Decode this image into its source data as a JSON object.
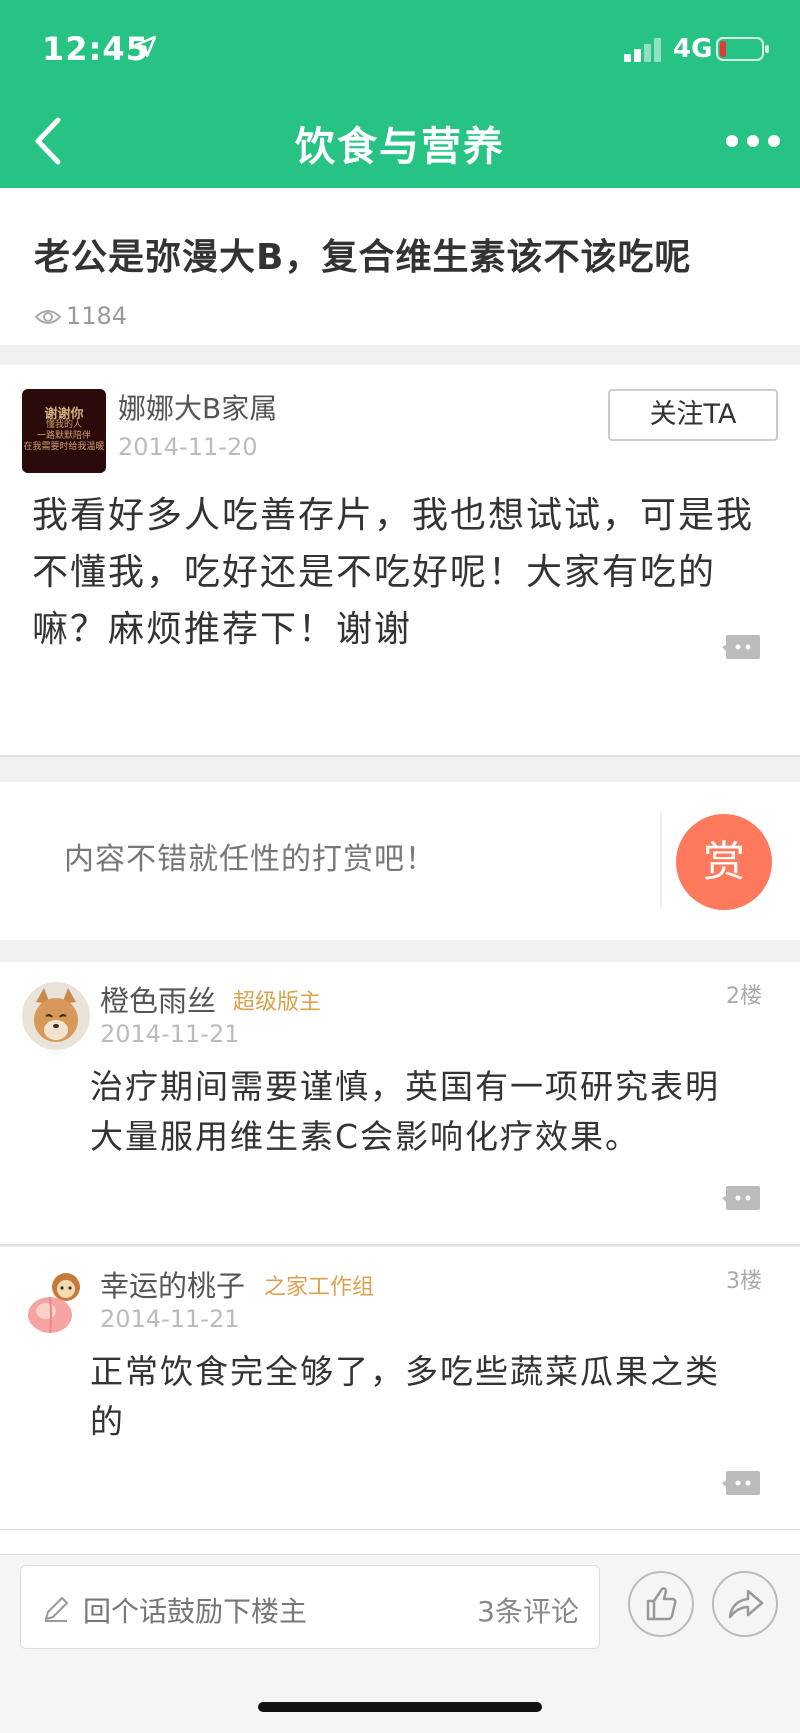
{
  "status_bar": {
    "time": "12:45",
    "network": "4G"
  },
  "header": {
    "title": "饮食与营养"
  },
  "post": {
    "title": "老公是弥漫大B，复合维生素该不该吃呢",
    "views": "1184"
  },
  "op": {
    "name": "娜娜大B家属",
    "date": "2014-11-20",
    "follow_label": "关注TA",
    "content": "我看好多人吃善存片，我也想试试，可是我不懂我，吃好还是不吃好呢！大家有吃的嘛？麻烦推荐下！谢谢",
    "avatar_text": {
      "line1": "谢谢你",
      "line2": "懂我的人",
      "line3": "一路默默陪伴",
      "line4": "在我需要时给我温暖"
    }
  },
  "tip": {
    "text": "内容不错就任性的打赏吧！",
    "button": "赏"
  },
  "replies": [
    {
      "name": "橙色雨丝",
      "badge": "超级版主",
      "floor": "2楼",
      "date": "2014-11-21",
      "content": "治疗期间需要谨慎，英国有一项研究表明大量服用维生素C会影响化疗效果。"
    },
    {
      "name": "幸运的桃子",
      "badge": "之家工作组",
      "floor": "3楼",
      "date": "2014-11-21",
      "content": "正常饮食完全够了，多吃些蔬菜瓜果之类的"
    }
  ],
  "bottom_bar": {
    "placeholder": "回个话鼓励下楼主",
    "comment_count": "3条评论"
  },
  "colors": {
    "brand": "#27c385",
    "tip": "#ff7a5c",
    "badge": "#d9a24c"
  }
}
